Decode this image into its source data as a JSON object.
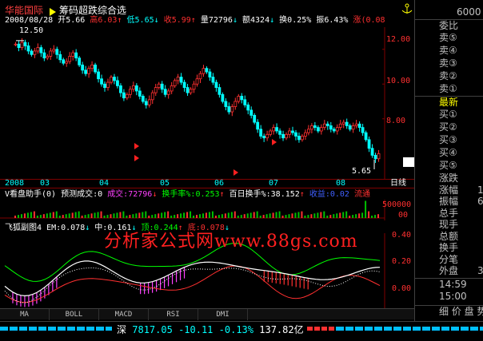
{
  "header": {
    "stock_name": "华能国际",
    "indicator_name": "筹码超跌综合选",
    "date": "2008/08/28",
    "open_label": "开",
    "open": "5.66",
    "high_label": "高",
    "high": "6.03",
    "low_label": "低",
    "low": "5.65",
    "close_label": "收",
    "close": "5.99",
    "vol_label": "量",
    "vol": "72796",
    "amt_label": "额",
    "amt": "4324",
    "turn_label": "换",
    "turn": "0.25%",
    "amp_label": "振",
    "amp": "6.43%",
    "chg_label": "涨",
    "chg": "(0.08"
  },
  "main_chart": {
    "max_marker": "12.50",
    "min_marker": "5.65",
    "last_price": "5.99",
    "y_ticks": [
      "12.00",
      "10.00",
      "8.00",
      "6.00"
    ],
    "x_labels": [
      "2008",
      "03",
      "04",
      "05",
      "06",
      "07",
      "08"
    ],
    "period_label": "日线"
  },
  "volume_pane": {
    "title": "V看盘助手(0) 预测成交:0",
    "chengjiao_label": "成交:",
    "chengjiao": "72796",
    "huanshou_label": "换手率%:",
    "huanshou": "0.253",
    "bairi_label": "百日换手%:",
    "bairi": "38.152",
    "shouyi_label": "收益:",
    "shouyi": "0.02",
    "liutong_label": "流通",
    "y_tick": "500000",
    "x_tick": "00"
  },
  "indicator_pane": {
    "title": "飞狐副图4",
    "em_label": "EM:",
    "em": "0.078",
    "zhong_label": "中:",
    "zhong": "0.161",
    "ding_label": "顶:",
    "ding": "0.244",
    "di_label": "底:",
    "di": "0.078",
    "y_ticks": [
      "0.40",
      "0.20",
      "0.00"
    ]
  },
  "watermark": "分析家公式网www.88gs.com",
  "tabs": [
    "MA",
    "BOLL",
    "MACD",
    "RSI",
    "DMI"
  ],
  "right_panel": {
    "top_price": "6000",
    "weibi": "委比",
    "sell": [
      "卖⑤",
      "卖④",
      "卖③",
      "卖②",
      "卖①"
    ],
    "latest": "最新",
    "buy": [
      "买①",
      "买②",
      "买③",
      "买④",
      "买⑤"
    ],
    "stats": [
      "涨跌",
      "涨幅",
      "振幅",
      "总手",
      "现手",
      "总额",
      "换手",
      "分笔",
      "外盘"
    ],
    "stat_values": [
      "",
      "1",
      "6",
      "",
      "",
      "",
      "",
      "",
      "3"
    ],
    "time1": "14:59",
    "time2": "15:00",
    "bottom_label": "细 价 盘 势"
  },
  "status": {
    "index_name": "深",
    "index_value": "7817.05",
    "index_chg": "-10.11",
    "index_pct": "-0.13%",
    "index_amt": "137.82亿"
  },
  "colors": {
    "up": "#ff3030",
    "down": "#00ffff",
    "axis": "#7f0000",
    "text": "#ffff00"
  },
  "chart_data": {
    "type": "candlestick",
    "y_range": [
      5.0,
      13.0
    ],
    "closes": [
      12.3,
      12.1,
      12.4,
      12.2,
      11.9,
      11.7,
      11.9,
      12.1,
      11.8,
      11.5,
      11.6,
      11.9,
      12.0,
      11.7,
      11.4,
      11.2,
      11.3,
      11.6,
      11.8,
      11.5,
      11.1,
      10.8,
      10.6,
      10.9,
      11.1,
      10.7,
      10.3,
      10.0,
      9.8,
      10.1,
      10.4,
      10.2,
      9.9,
      9.5,
      9.2,
      9.4,
      9.7,
      9.9,
      9.6,
      9.3,
      9.0,
      8.8,
      9.1,
      9.5,
      9.8,
      10.0,
      9.7,
      9.4,
      9.6,
      9.9,
      10.2,
      10.4,
      10.1,
      9.8,
      9.5,
      9.7,
      10.0,
      10.3,
      10.6,
      10.9,
      10.7,
      10.4,
      10.1,
      9.8,
      9.4,
      9.0,
      8.7,
      8.4,
      8.7,
      9.0,
      9.3,
      9.1,
      8.8,
      8.5,
      8.2,
      7.8,
      7.4,
      7.0,
      6.9,
      7.1,
      7.3,
      7.5,
      7.3,
      7.1,
      6.9,
      7.1,
      7.3,
      7.2,
      7.0,
      6.8,
      7.0,
      7.2,
      7.4,
      7.6,
      7.5,
      7.3,
      7.5,
      7.7,
      7.6,
      7.4,
      7.3,
      7.5,
      7.7,
      7.8,
      7.6,
      7.4,
      7.6,
      7.7,
      7.5,
      7.2,
      6.8,
      6.3,
      5.9,
      5.7,
      5.99
    ]
  }
}
